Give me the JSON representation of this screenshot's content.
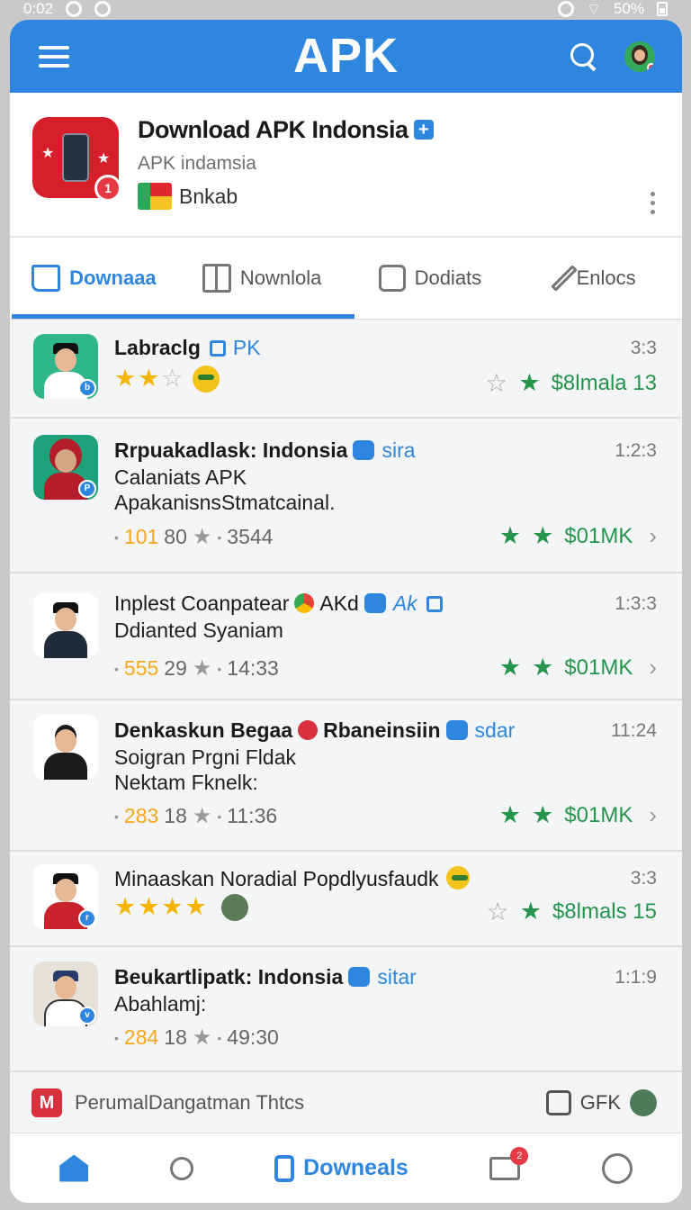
{
  "status": {
    "time": "0:02",
    "battery": "50%"
  },
  "appbar": {
    "title": "APK"
  },
  "hero": {
    "title": "Download APK Indonsia",
    "subtitle": "APK indamsia",
    "tag": "Bnkab",
    "badge": "1"
  },
  "tabs": [
    {
      "label": "Downaaa",
      "active": true
    },
    {
      "label": "Nownlola",
      "active": false
    },
    {
      "label": "Dodiats",
      "active": false
    },
    {
      "label": "Enlocs",
      "active": false
    }
  ],
  "items": [
    {
      "name": "Labraclg",
      "tag": "PK",
      "time": "3:3",
      "price": "$8lmala 13",
      "rating_stars": 2.5
    },
    {
      "name": "Rrpuakadlask: Indonsia",
      "tag": "sira",
      "time": "1:2:3",
      "line2": "Calaniats APK",
      "line3": "ApakanisnsStmatcainal.",
      "num_a": "101",
      "num_b": "80",
      "num_c": "3544",
      "price": "$01MK"
    },
    {
      "name": "Inplest Coanpatear",
      "extra": "AKd",
      "tag": "Ak",
      "time": "1:3:3",
      "line2": "Ddianted Syaniam",
      "num_a": "555",
      "num_b": "29",
      "num_c": "14:33",
      "price": "$01MK"
    },
    {
      "name": "Denkaskun Begaa",
      "extra": "Rbaneinsiin",
      "tag": "sdar",
      "time": "11:24",
      "line2": "Soigran Prgni Fldak",
      "line3": "Nektam Fknelk:",
      "num_a": "283",
      "num_b": "18",
      "num_c": "11:36",
      "price": "$01MK"
    },
    {
      "name": "Minaaskan Noradial  Popdlyusfaudk",
      "time": "3:3",
      "price": "$8lmals 15",
      "rating_stars": 4
    },
    {
      "name": "Beukartlipatk: Indonsia",
      "tag": "sitar",
      "time": "1:1:9",
      "line2": "Abahlamj:",
      "num_a": "284",
      "num_b": "18",
      "num_c": "49:30"
    }
  ],
  "promo": {
    "text": "PerumalDangatman Thtcs",
    "right": "GFK",
    "icon": "M"
  },
  "bottomnav": [
    {
      "label": "",
      "icon": "home-icon"
    },
    {
      "label": "",
      "icon": "search-icon"
    },
    {
      "label": "Downeals",
      "icon": "download-icon"
    },
    {
      "label": "",
      "icon": "mail-icon",
      "badge": "2"
    },
    {
      "label": "",
      "icon": "profile-icon"
    }
  ]
}
